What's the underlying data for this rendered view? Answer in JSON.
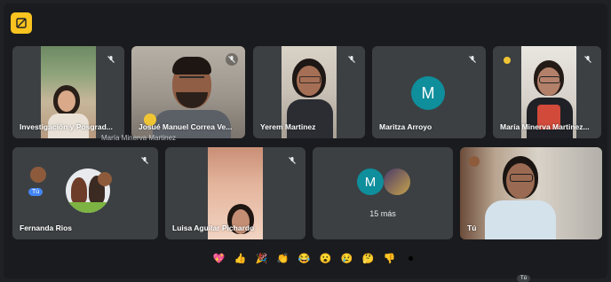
{
  "participants": [
    {
      "name": "Investigación y Posgrad..."
    },
    {
      "name": "Josué Manuel Correa Ve..."
    },
    {
      "name": "Yerem Martinez"
    },
    {
      "name": "Maritza Arroyo",
      "initial": "M"
    },
    {
      "name": "María Minerva Martinez..."
    },
    {
      "name": "Fernanda Rios"
    },
    {
      "name": "Luisa Aguilar Pichardo"
    },
    {
      "name": "Tú"
    }
  ],
  "overlay_name": "María Minerva Martinez",
  "group_tile": {
    "initial": "M",
    "more_label": "15 más"
  },
  "self_badge": "Tú",
  "self_badge_2": "Tú",
  "reactions": [
    "💖",
    "👍",
    "🎉",
    "👏",
    "😂",
    "😮",
    "😢",
    "🤔",
    "👎",
    "⏺"
  ],
  "colors": {
    "tile_bg": "#3c4043",
    "avatar_teal": "#0f8e9c",
    "badge_yellow": "#f9c320"
  }
}
